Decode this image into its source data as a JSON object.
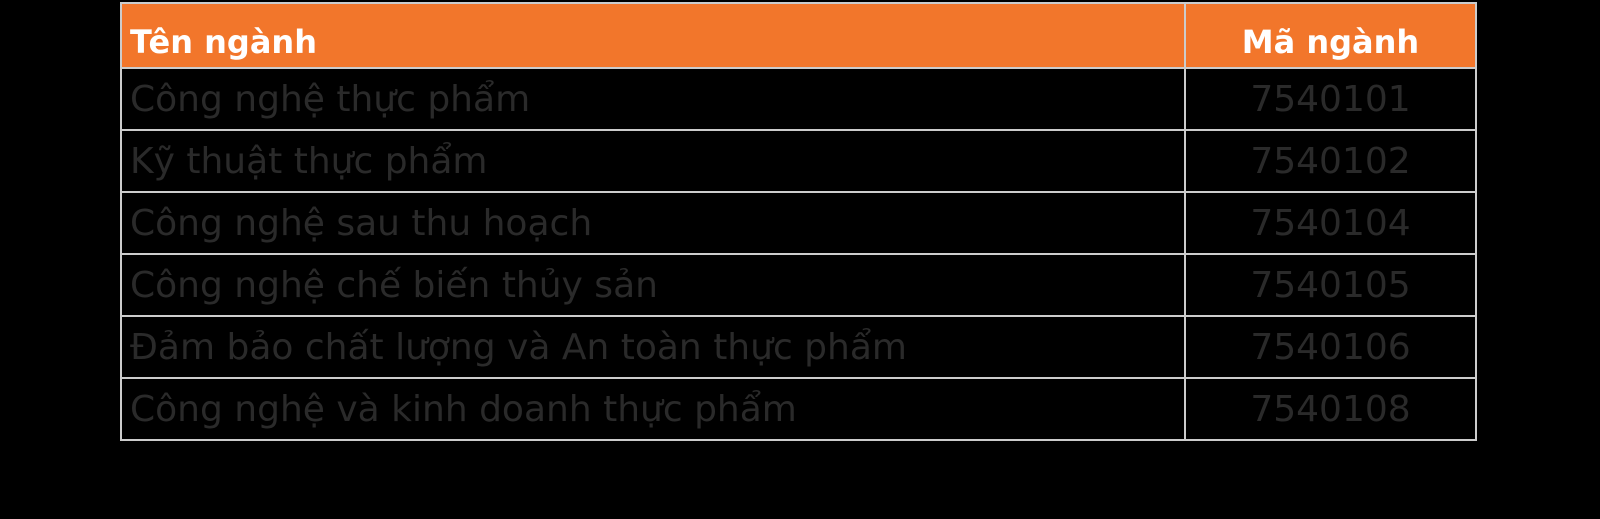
{
  "table": {
    "header": {
      "name": "Tên ngành",
      "code": "Mã ngành"
    },
    "rows": [
      {
        "name": "Công nghệ thực phẩm",
        "code": "7540101"
      },
      {
        "name": "Kỹ thuật thực phẩm",
        "code": "7540102"
      },
      {
        "name": "Công nghệ sau thu hoạch",
        "code": "7540104"
      },
      {
        "name": "Công nghệ chế biến thủy sản",
        "code": "7540105"
      },
      {
        "name": "Đảm bảo chất lượng và An toàn thực phẩm",
        "code": "7540106"
      },
      {
        "name": "Công nghệ và kinh doanh thực phẩm",
        "code": "7540108"
      }
    ]
  },
  "colors": {
    "header_background": "#f2762b",
    "header_text": "#ffffff",
    "cell_text": "#2a2a2a",
    "border": "#cccccc",
    "page_background": "#000000"
  }
}
